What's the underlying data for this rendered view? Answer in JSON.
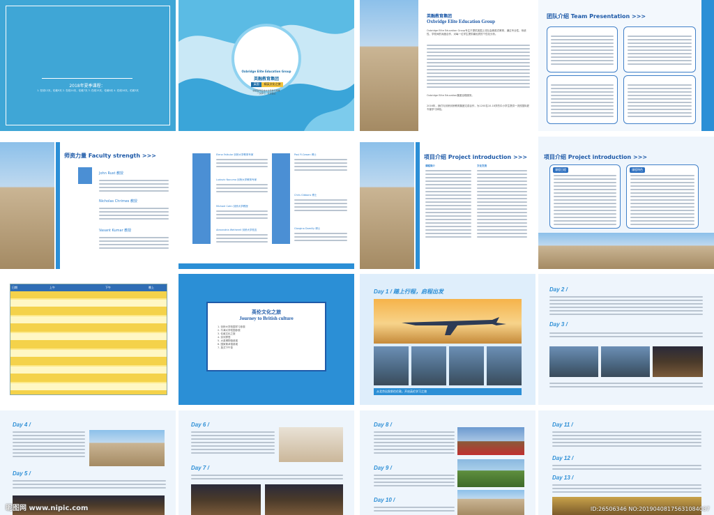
{
  "cover": {
    "left_heading": "2018年夏季课程：",
    "left_body": "1. 在线12天，伦敦9天 2. 在线14天，伦敦7天 3. 在线15天，伦敦6天 4. 在线18天，伦敦3天",
    "brand_en": "Oxbridge Elite Education Group",
    "brand_cn": "英融教育集团",
    "badge_left": "英国",
    "badge_right": "精英文化之旅",
    "tagline_1": "感悟百年名校文化传承与荣耀",
    "tagline_2": "一次学习，永远铭记"
  },
  "intro": {
    "title_cn": "英融教育集团",
    "title_en": "Oxbridge Elite Education Group",
    "para_1": "Oxbridge Elite Education Group专注于提供英国上流社会精英式教育，通过专业性、系统性、学校间的深度合作，对每一位学生提供最优质的个性化分析。",
    "para_2": "Oxbridge Elite Education集团全程服务。",
    "para_3": "2016年，我们与剑桥剑桥教育集团达成合作，为1200名10-18岁的中小学生提供一流的国际夏令营学习体验。"
  },
  "team": {
    "title": "团队介绍 Team Presentation >>>"
  },
  "faculty": {
    "title": "师资力量 Faculty strength >>>",
    "names": [
      "John Rust 教授",
      "Nicholas Chrimes 教授",
      "Vasant Kumar 教授"
    ],
    "names_page2": [
      "Elena Falkulor 剑桥大学教育专家",
      "Ludovic Nocumo 剑桥大学教育专家",
      "Michael Cahn 剑桥大学教授",
      "Alexandria Wetherell 剑桥大学校友",
      "Paul R.Cowan 博士",
      "Chris Gibbons 博士",
      "Giorgina Domilly 博士"
    ]
  },
  "project": {
    "title": "项目介绍 Project introduction >>>",
    "box_labels": [
      "课程简介",
      "文化交流",
      "课程日程",
      "课程特色"
    ]
  },
  "schedule": {
    "headers": [
      "日期",
      "上午",
      "下午",
      "晚上"
    ]
  },
  "culture": {
    "title_cn": "英伦文化之旅",
    "title_en": "Journey to British culture",
    "items": [
      "1. 剑桥大学校园学习参观",
      "2. 牛津大学校园参观",
      "3. 伦敦文化之旅",
      "4. 剑河撑篙",
      "5. 大英博物馆参观",
      "6. 国家美术馆参观",
      "7. 英式下午茶"
    ]
  },
  "day1": {
    "title": "Day 1 / 踏上行程，启程出发",
    "caption": "从北京出发前往伦敦，开启英伦学习之旅"
  },
  "days": [
    "Day 2 /",
    "Day 3 /",
    "Day 4 /",
    "Day 5 /",
    "Day 6 /",
    "Day 7 /",
    "Day 8 /",
    "Day 9 /",
    "Day 10 /",
    "Day 11 /",
    "Day 12 /",
    "Day 13 /"
  ],
  "watermark": {
    "left": "昵图网 www.nipic.com",
    "right": "ID:26506346 NO:20190408175631084087"
  }
}
